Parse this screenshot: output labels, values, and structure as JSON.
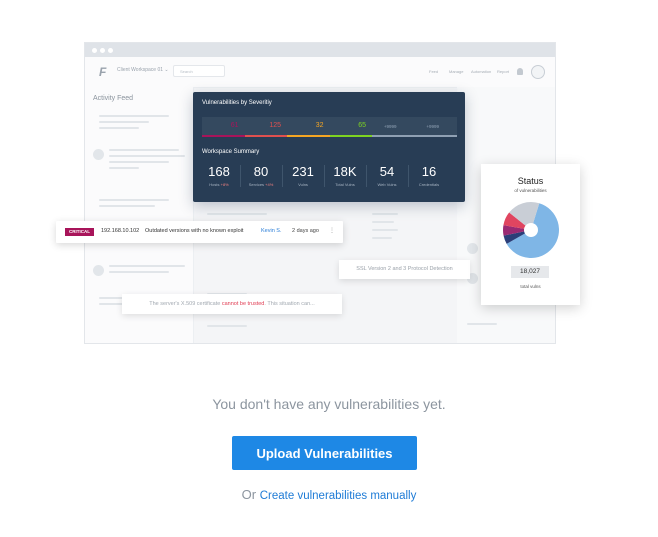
{
  "illustration": {
    "app": {
      "logo": "F",
      "workspace_select": "Client Workspace 01 ⌄",
      "search_placeholder": "Search",
      "nav": [
        "Feed",
        "Manage",
        "Automation",
        "Report"
      ]
    },
    "activity_feed": {
      "title": "Activity Feed"
    },
    "vulns_card": {
      "title": "Vulnerabilities by Severitiy",
      "severity_values": [
        "61",
        "125",
        "32",
        "65",
        "+9999",
        "+9999"
      ],
      "severity_colors": [
        "#a8145a",
        "#e0504f",
        "#f5a623",
        "#7ed321",
        "#8fa0b3",
        "#8fa0b3"
      ],
      "workspace_title": "Workspace Summary",
      "stats": [
        {
          "value": "168",
          "label": "Hosts",
          "delta": "+8%"
        },
        {
          "value": "80",
          "label": "Services",
          "delta": "+4%"
        },
        {
          "value": "231",
          "label": "Vulns",
          "delta": ""
        },
        {
          "value": "18K",
          "label": "Total Vulns",
          "delta": ""
        },
        {
          "value": "54",
          "label": "Web Vulns",
          "delta": ""
        },
        {
          "value": "16",
          "label": "Credentials",
          "delta": ""
        }
      ]
    },
    "alert_row": {
      "severity": "CRITICAL",
      "ip": "192.168.10.102",
      "message": "Outdated versions with no known exploit",
      "user": "Kevin S.",
      "time": "2 days ago",
      "more": "⋮"
    },
    "ssl_chip": "SSL Version 2 and 3 Protocol Detection",
    "cert_chip": {
      "before": "The server's X.509 certificate",
      "highlight": "cannot be trusted",
      "after": ". This situation can..."
    },
    "status_card": {
      "title": "Status",
      "subtitle": "of vulnerabilities",
      "total": "18,027",
      "total_label": "total vulns",
      "slices": [
        {
          "fraction": 0.62,
          "color": "#7fb6e6"
        },
        {
          "fraction": 0.05,
          "color": "#2b3e78"
        },
        {
          "fraction": 0.06,
          "color": "#9a2a72"
        },
        {
          "fraction": 0.08,
          "color": "#e04560"
        },
        {
          "fraction": 0.19,
          "color": "#c9ced6"
        }
      ]
    }
  },
  "empty_state": {
    "message": "You don't have any vulnerabilities yet.",
    "button_label": "Upload Vulnerabilities",
    "or_text": "Or",
    "link_label": "Create vulnerabilities manually"
  },
  "colors": {
    "accent": "#1e88e5",
    "link": "#1e7bd6",
    "card_dark": "#283d55",
    "critical": "#a8145a"
  }
}
